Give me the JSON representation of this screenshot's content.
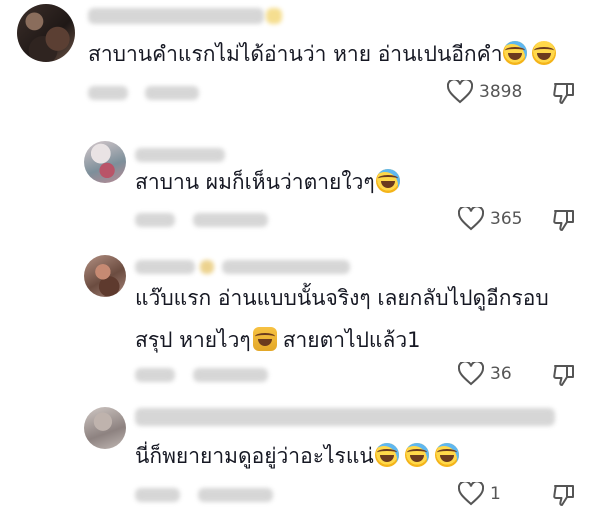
{
  "comments": [
    {
      "text": "สาบานคำแรกไม่ได้อ่านว่า หาย อ่านเปนอีกคำ",
      "emojis": [
        "face-with-tears-of-joy",
        "grinning-face-with-sweat"
      ],
      "likes": "3898"
    },
    {
      "text": "สาบาน ผมก็เห็นว่าตายใวๆ",
      "emojis": [
        "face-with-tears-of-joy"
      ],
      "likes": "365"
    },
    {
      "text_line1": "แว๊บแรก อ่านแบบนั้นจริงๆ เลยกลับไปดูอีกรอบ",
      "text_line2_part1": "สรุป หายไวๆ",
      "text_line2_part2": "สายตาไปแล้ว1",
      "emojis": [
        "person-facepalming"
      ],
      "likes": "36"
    },
    {
      "text": "นี่ก็พยายามดูอยู่ว่าอะไรแน่",
      "emojis": [
        "face-with-tears-of-joy",
        "face-with-tears-of-joy",
        "face-with-tears-of-joy"
      ],
      "likes": "1"
    }
  ],
  "icons": {
    "like": "heart-outline-icon",
    "dislike": "thumbs-down-outline-icon"
  },
  "colors": {
    "text": "#161823",
    "secondary": "#555555",
    "blurred": "#c9c9c9"
  }
}
